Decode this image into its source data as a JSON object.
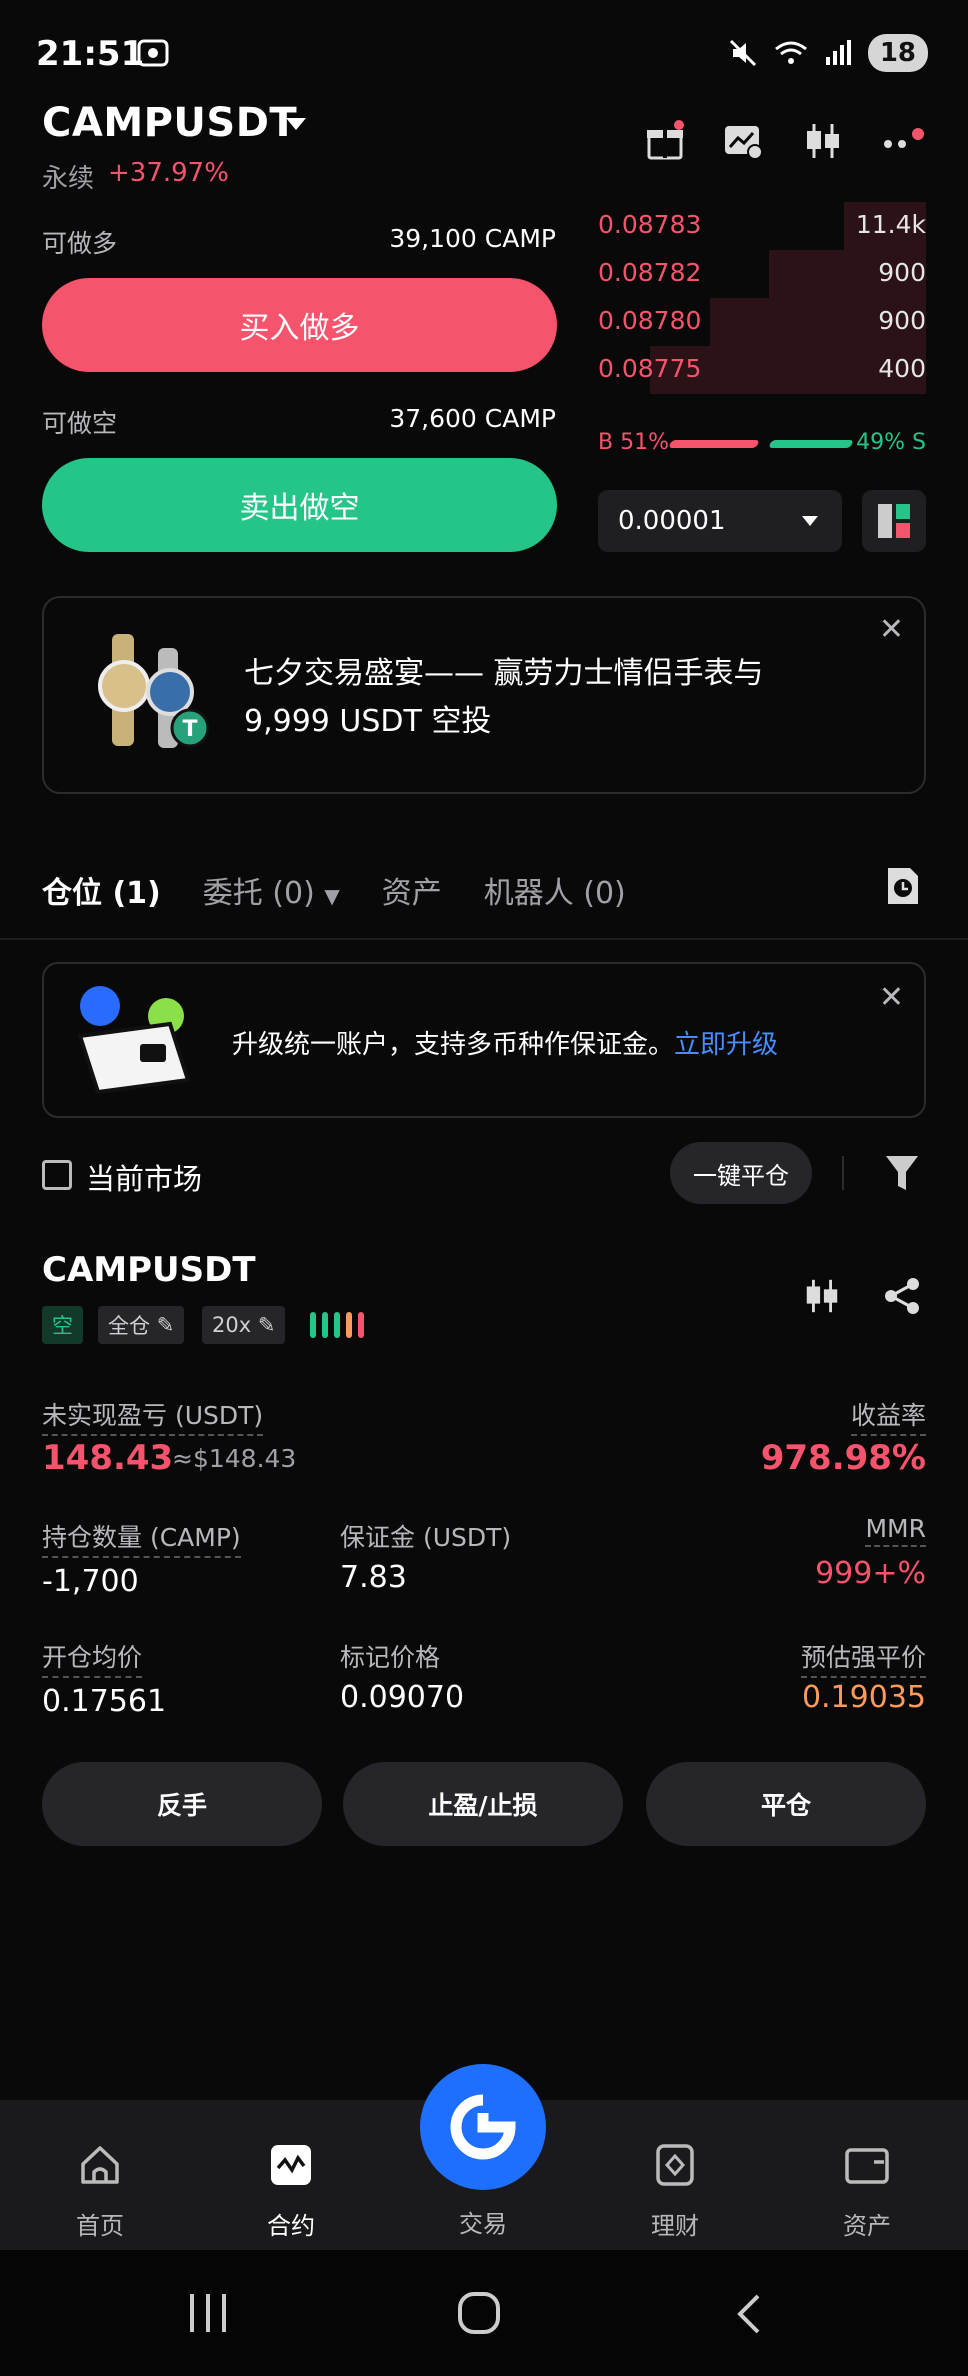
{
  "status_bar": {
    "time": "21:51",
    "battery": "18"
  },
  "header": {
    "symbol": "CAMPUSDT",
    "type": "永续",
    "change": "+37.97%"
  },
  "order_panel": {
    "long_label": "可做多",
    "long_value": "39,100 CAMP",
    "long_button": "买入做多",
    "short_label": "可做空",
    "short_value": "37,600 CAMP",
    "short_button": "卖出做空"
  },
  "order_book": {
    "asks": [
      {
        "price": "0.08783",
        "qty": "11.4k",
        "depth": 0.3
      },
      {
        "price": "0.08782",
        "qty": "900",
        "depth": 0.5
      },
      {
        "price": "0.08780",
        "qty": "900",
        "depth": 0.7
      },
      {
        "price": "0.08775",
        "qty": "400",
        "depth": 0.9
      }
    ],
    "buy_ratio": "B 51%",
    "sell_ratio": "49% S",
    "precision": "0.00001"
  },
  "banner": {
    "text": "七夕交易盛宴—— 赢劳力士情侣手表与 9,999 USDT 空投"
  },
  "tabs": [
    {
      "label": "仓位 (1)"
    },
    {
      "label": "委托 (0)"
    },
    {
      "label": "资产"
    },
    {
      "label": "机器人 (0)"
    }
  ],
  "upgrade": {
    "text": "升级统一账户，支持多币种作保证金。",
    "link": "立即升级"
  },
  "filter": {
    "current_market": "当前市场",
    "close_all": "一键平仓"
  },
  "position": {
    "symbol": "CAMPUSDT",
    "side": "空",
    "margin_mode": "全仓",
    "leverage": "20x",
    "unrealized_pnl_label": "未实现盈亏 (USDT)",
    "unrealized_pnl": "148.43",
    "unrealized_pnl_usd": "≈$148.43",
    "roe_label": "收益率",
    "roe": "978.98%",
    "size_label": "持仓数量 (CAMP)",
    "size": "-1,700",
    "margin_label": "保证金 (USDT)",
    "margin": "7.83",
    "mmr_label": "MMR",
    "mmr": "999+%",
    "entry_label": "开仓均价",
    "entry": "0.17561",
    "mark_label": "标记价格",
    "mark": "0.09070",
    "liq_label": "预估强平价",
    "liq": "0.19035",
    "btn_reverse": "反手",
    "btn_tpsl": "止盈/止损",
    "btn_close": "平仓"
  },
  "bottom_nav": [
    {
      "label": "首页"
    },
    {
      "label": "合约"
    },
    {
      "label": "交易"
    },
    {
      "label": "理财"
    },
    {
      "label": "资产"
    }
  ],
  "colors": {
    "red": "#f6536c",
    "green": "#25c58a",
    "blue": "#1f6fff",
    "orange": "#ff9a5a"
  }
}
